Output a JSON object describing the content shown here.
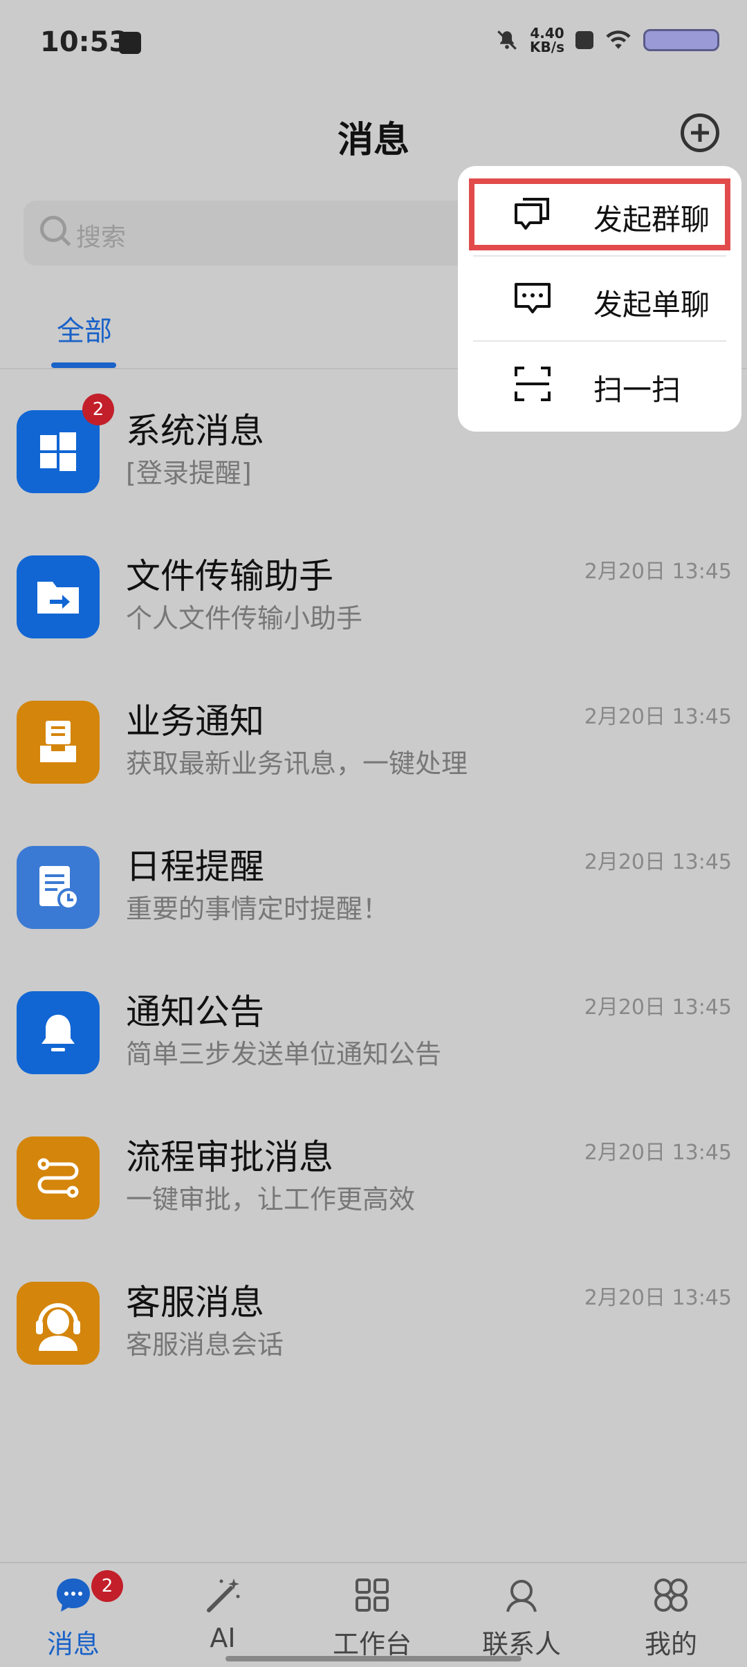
{
  "status_bar": {
    "time": "10:53",
    "net_speed_value": "4.40",
    "net_speed_unit": "KB/s"
  },
  "header": {
    "title": "消息"
  },
  "search": {
    "placeholder": "搜索"
  },
  "tabs": [
    {
      "label": "全部"
    }
  ],
  "popup_menu": {
    "items": [
      {
        "label": "发起群聊",
        "icon": "group-chat-icon"
      },
      {
        "label": "发起单聊",
        "icon": "single-chat-icon"
      },
      {
        "label": "扫一扫",
        "icon": "scan-icon"
      }
    ]
  },
  "messages": [
    {
      "name": "系统消息",
      "desc": "[登录提醒]",
      "time": "",
      "badge": "2",
      "icon": "windows-icon",
      "color": "#1166d4"
    },
    {
      "name": "文件传输助手",
      "desc": "个人文件传输小助手",
      "time": "2月20日 13:45",
      "icon": "folder-transfer-icon",
      "color": "#1166d4"
    },
    {
      "name": "业务通知",
      "desc": "获取最新业务讯息，一键处理",
      "time": "2月20日 13:45",
      "icon": "inbox-icon",
      "color": "#d4850b"
    },
    {
      "name": "日程提醒",
      "desc": "重要的事情定时提醒！",
      "time": "2月20日 13:45",
      "icon": "schedule-icon",
      "color": "#3b7ad4"
    },
    {
      "name": "通知公告",
      "desc": "简单三步发送单位通知公告",
      "time": "2月20日 13:45",
      "icon": "bell-icon",
      "color": "#1166d4"
    },
    {
      "name": "流程审批消息",
      "desc": "一键审批，让工作更高效",
      "time": "2月20日 13:45",
      "icon": "workflow-icon",
      "color": "#d4850b"
    },
    {
      "name": "客服消息",
      "desc": "客服消息会话",
      "time": "2月20日 13:45",
      "icon": "headset-agent-icon",
      "color": "#d4850b"
    }
  ],
  "bottom_nav": [
    {
      "label": "消息",
      "badge": "2",
      "active": true
    },
    {
      "label": "AI"
    },
    {
      "label": "工作台"
    },
    {
      "label": "联系人"
    },
    {
      "label": "我的"
    }
  ],
  "colors": {
    "accent": "#1a62c8",
    "badge": "#c21f2a",
    "highlight": "#e24b4b"
  }
}
